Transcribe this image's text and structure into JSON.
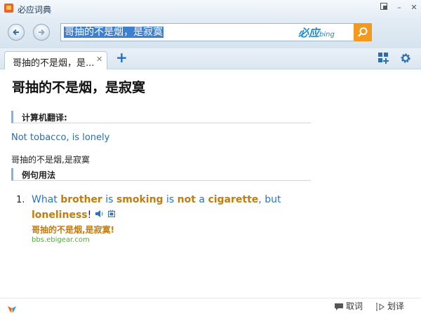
{
  "titlebar": {
    "title": "必应词典"
  },
  "search": {
    "query": "哥抽的不是烟，是寂寞",
    "brand_cn": "必应",
    "brand_en": "bing"
  },
  "tabs": [
    {
      "label": "哥抽的不是烟，是..."
    }
  ],
  "result": {
    "headword": "哥抽的不是烟，是寂寞",
    "machine_translation_heading": "计算机翻译:",
    "machine_translation": "Not tobacco, is lonely",
    "source_text": "哥抽的不是烟,是寂寞",
    "examples_heading": "例句用法",
    "examples": [
      {
        "number": "1.",
        "en_parts": [
          "What ",
          "brother",
          " is ",
          "smoking",
          " is ",
          "not",
          " a ",
          "cigarette",
          ", but"
        ],
        "en_line2": [
          "loneliness",
          "!"
        ],
        "cn": "哥抽的不是烟,是寂寞!",
        "source": "bbs.ebigear.com"
      }
    ]
  },
  "bottom": {
    "lookup_label": "取词",
    "select_label": "划译"
  },
  "colors": {
    "accent": "#1f6fbf",
    "highlight": "#c47b10",
    "source_green": "#59a542",
    "search_button": "#f39a1e"
  }
}
